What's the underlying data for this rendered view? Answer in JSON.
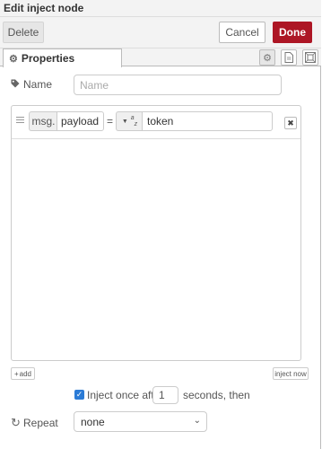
{
  "dialog": {
    "title": "Edit inject node"
  },
  "toolbar": {
    "delete_label": "Delete",
    "cancel_label": "Cancel",
    "done_label": "Done"
  },
  "tabs": {
    "properties_label": "Properties",
    "icons": [
      "gear-icon",
      "description-icon",
      "appearance-icon"
    ]
  },
  "form": {
    "name_label": "Name",
    "name_placeholder": "Name",
    "name_value": "",
    "property_rows": [
      {
        "prefix": "msg.",
        "field": "payload",
        "operator": "=",
        "type_icon": "string-type-icon",
        "type_glyph": "a z",
        "value": "token"
      }
    ],
    "add_label": "add",
    "inject_now_label": "inject now",
    "inject_once_label": "Inject once after",
    "inject_once_checked": true,
    "inject_once_seconds": "1",
    "seconds_suffix": "seconds, then",
    "repeat_label": "Repeat",
    "repeat_value": "none"
  },
  "colors": {
    "done_button": "#ad1625",
    "checkbox": "#2b7bd6"
  }
}
